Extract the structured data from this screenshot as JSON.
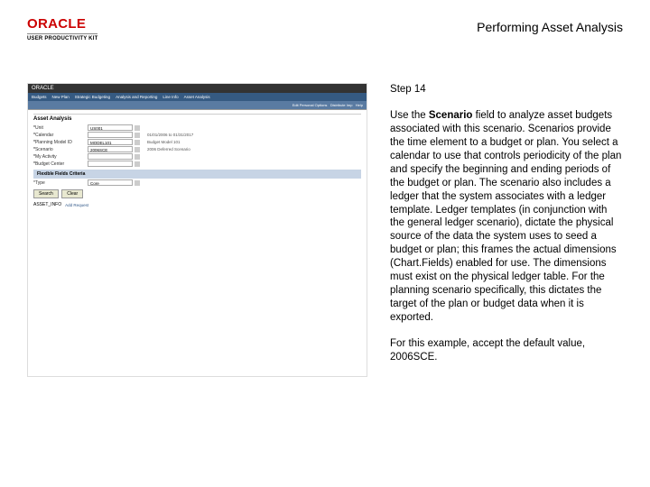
{
  "header": {
    "brand": "ORACLE",
    "sub_brand": "USER PRODUCTIVITY KIT",
    "doc_title": "Performing Asset Analysis"
  },
  "screenshot": {
    "topbar": "ORACLE",
    "nav": [
      "Budgets",
      "New Plan",
      "Strategic Budgeting",
      "Analysis and Reporting",
      "Line Info",
      "Asset Analysis"
    ],
    "subnav_left": "",
    "subnav_right_items": [
      "Edit Personal Options",
      "Distribute Imp",
      "Help"
    ],
    "panel_title": "Asset Analysis",
    "fields": [
      {
        "label": "Unit",
        "value": "US001",
        "req": true,
        "desc": ""
      },
      {
        "label": "Calendar",
        "value": "",
        "req": true,
        "desc": "01/01/2006 to 01/31/2017"
      },
      {
        "label": "Planning Model ID",
        "value": "MODEL101",
        "req": true,
        "desc": "Budget Model 101"
      },
      {
        "label": "Scenario",
        "value": "2006SCE",
        "req": true,
        "desc": "2006 Deferred Scenario"
      },
      {
        "label": "My Activity",
        "value": "",
        "req": true,
        "desc": ""
      },
      {
        "label": "Budget Center",
        "value": "",
        "req": true,
        "desc": ""
      }
    ],
    "section_bar": "Flexible Fields Criteria",
    "flex_field": {
      "label": "*Type",
      "value": "Core"
    },
    "buttons": [
      "Search",
      "Clear"
    ],
    "bottom_left": "ASSET_INFO",
    "bottom_link": "Add Request"
  },
  "instructions": {
    "step": "Step 14",
    "p1_pre": "Use the ",
    "p1_bold": "Scenario",
    "p1_post": " field to analyze asset budgets associated with this scenario. Scenarios provide the time element to a budget or plan. You select a calendar to use that controls periodicity of the plan and specify the beginning and ending periods of the budget or plan. The scenario also includes a ledger that the system associates with a ledger template. Ledger templates (in conjunction with the general ledger scenario), dictate the physical source of the data the system uses to seed a budget or plan; this frames the actual dimensions (Chart.Fields) enabled for use. The dimensions must exist on the physical ledger table. For the planning scenario specifically, this dictates the target of the plan or budget data when it is exported.",
    "p2": "For this example, accept the default value, 2006SCE."
  }
}
